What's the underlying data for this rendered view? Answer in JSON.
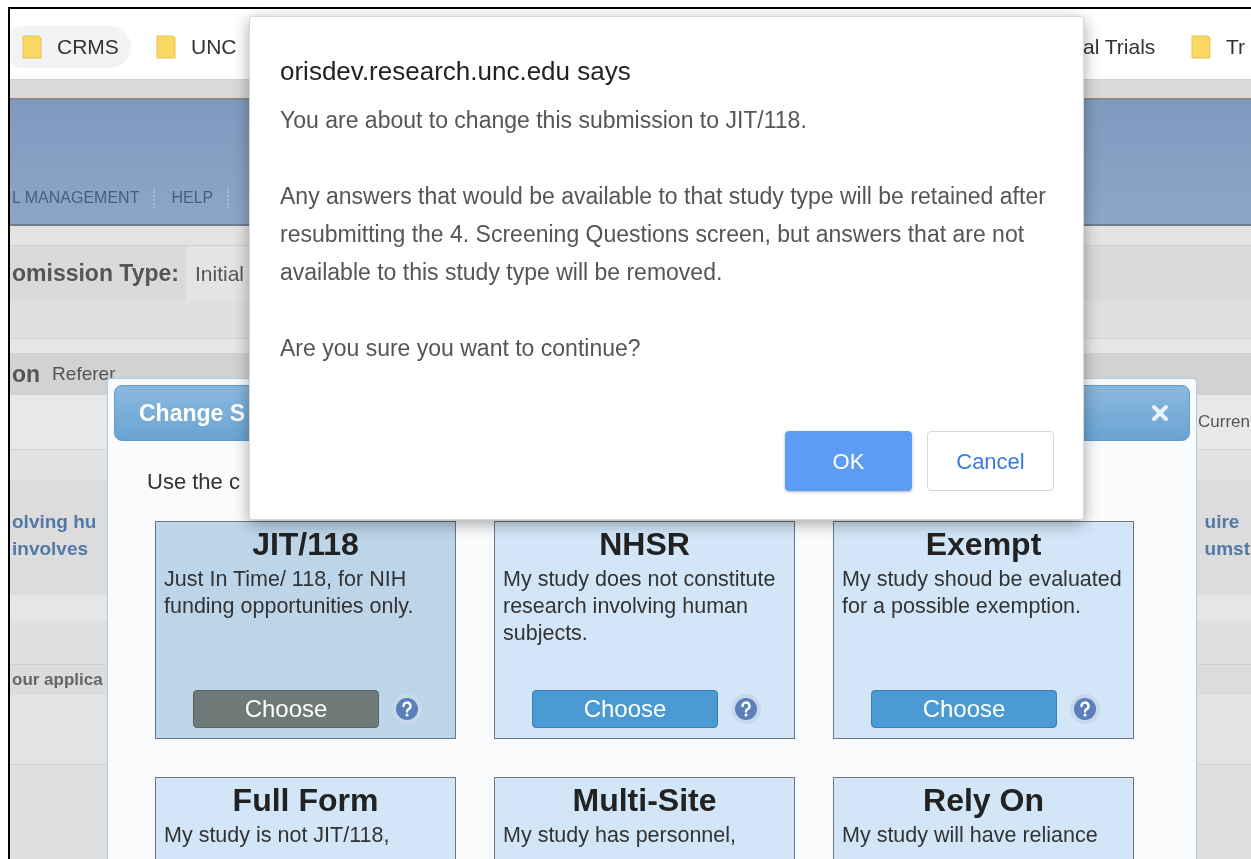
{
  "bookmarks": [
    {
      "label": "CRMS",
      "hovered": true,
      "folder": true
    },
    {
      "label": "UNC",
      "hovered": false,
      "folder": true
    },
    {
      "label": "al Trials",
      "hovered": false,
      "folder": false
    },
    {
      "label": "Tr",
      "hovered": false,
      "folder": true
    }
  ],
  "nav": [
    "L MANAGEMENT",
    "HELP"
  ],
  "page": {
    "submission_label": "omission Type:",
    "submission_value": "Initial",
    "section_label": "on",
    "reference_label": "Referer",
    "right_header": "Curren",
    "left_link_lines": [
      "olving hu",
      "involves"
    ],
    "right_link_lines": [
      "uire",
      "umst"
    ],
    "left_note": "our applica"
  },
  "modal": {
    "title": "Change S",
    "intro": "Use the c",
    "options": [
      {
        "title": "JIT/118",
        "description": "Just In Time/ 118, for NIH funding opportunities only.",
        "button": "Choose",
        "selected": true
      },
      {
        "title": "NHSR",
        "description": "My study does not constitute research involving human subjects.",
        "button": "Choose",
        "selected": false
      },
      {
        "title": "Exempt",
        "description": "My study shoud be evaluated for a possible exemption.",
        "button": "Choose",
        "selected": false
      },
      {
        "title": "Full Form",
        "description": "My study is not JIT/118,",
        "selected": false
      },
      {
        "title": "Multi-Site",
        "description": "My study has personnel,",
        "selected": false
      },
      {
        "title": "Rely On",
        "description": "My study will have reliance",
        "selected": false
      }
    ]
  },
  "alert": {
    "title": "orisdev.research.unc.edu says",
    "paragraphs": [
      "You are about to change this submission to JIT/118.",
      "Any answers that would be available to that study type will be retained after resubmitting the 4. Screening Questions screen, but answers that are not available to this study type will be removed.",
      "Are you sure you want to continue?"
    ],
    "buttons": [
      {
        "label": "OK",
        "kind": "primary"
      },
      {
        "label": "Cancel",
        "kind": "secondary"
      }
    ]
  }
}
